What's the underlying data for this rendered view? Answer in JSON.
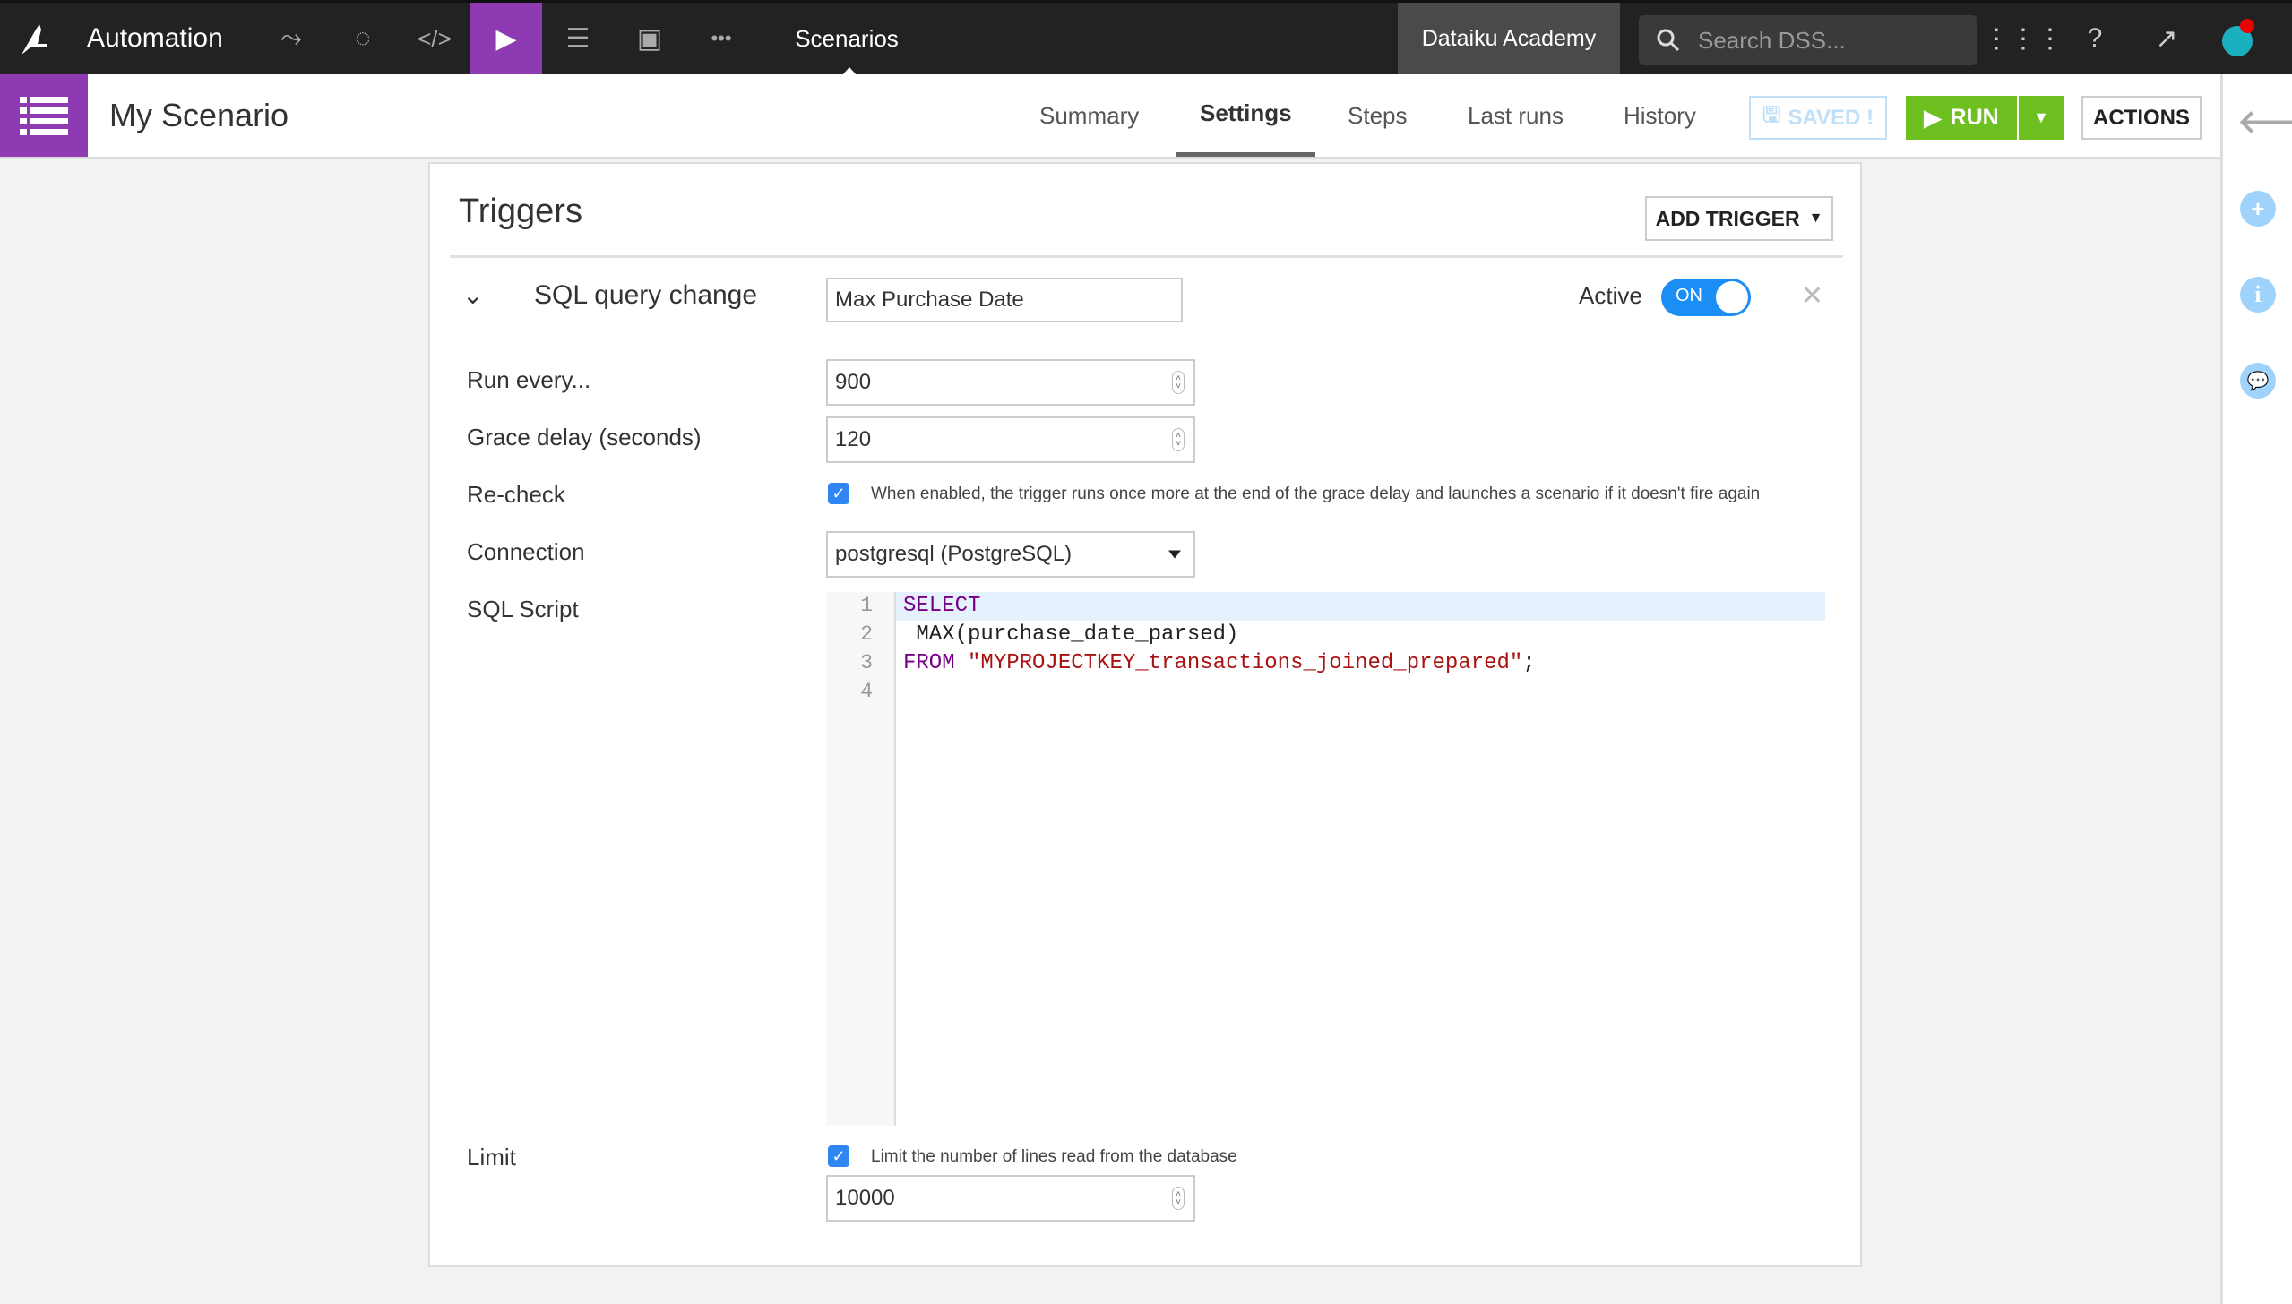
{
  "topbar": {
    "app_title": "Automation",
    "nav_icons": [
      "flow-icon",
      "lifecycle-icon",
      "code-icon",
      "run-scenario-icon",
      "datasets-icon",
      "dashboard-icon",
      "more-icon"
    ],
    "section": "Scenarios",
    "instance": "Dataiku Academy",
    "search_placeholder": "Search DSS..."
  },
  "subbar": {
    "title": "My Scenario",
    "tabs": [
      {
        "label": "Summary",
        "active": false
      },
      {
        "label": "Settings",
        "active": true
      },
      {
        "label": "Steps",
        "active": false
      },
      {
        "label": "Last runs",
        "active": false
      },
      {
        "label": "History",
        "active": false
      }
    ],
    "saved_label": "SAVED !",
    "run_label": "RUN",
    "actions_label": "ACTIONS"
  },
  "triggers": {
    "title": "Triggers",
    "add_label": "ADD TRIGGER",
    "trigger": {
      "type": "SQL query change",
      "name": "Max Purchase Date",
      "active_label": "Active",
      "toggle_label": "ON",
      "fields": {
        "run_every_label": "Run every...",
        "run_every_value": "900",
        "grace_label": "Grace delay (seconds)",
        "grace_value": "120",
        "recheck_label": "Re-check",
        "recheck_checked": true,
        "recheck_text": "When enabled, the trigger runs once more at the end of the grace delay and launches a scenario if it doesn't fire again",
        "connection_label": "Connection",
        "connection_value": "postgresql (PostgreSQL)",
        "sql_label": "SQL Script",
        "limit_label": "Limit",
        "limit_checked": true,
        "limit_text": "Limit the number of lines read from the database",
        "limit_value": "10000"
      },
      "sql": {
        "line_numbers": [
          "1",
          "2",
          "3",
          "4"
        ],
        "l1_kw": "SELECT",
        "l2": " MAX(purchase_date_parsed)",
        "l3_kw": "FROM",
        "l3_str": "\"MYPROJECTKEY_transactions_joined_prepared\"",
        "l3_end": ";"
      }
    }
  }
}
